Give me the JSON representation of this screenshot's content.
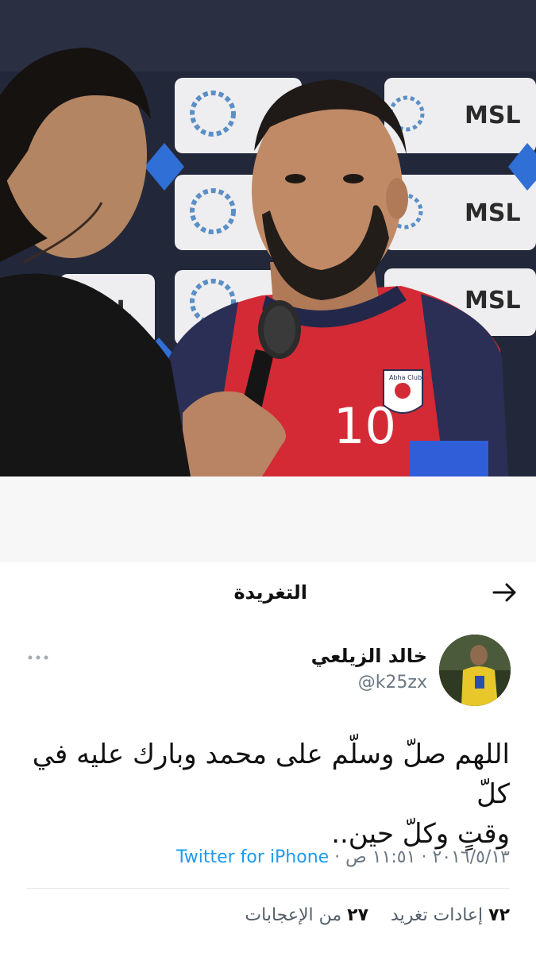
{
  "photo": {
    "backdrop_logo_text": "MSL",
    "jersey_number": "10",
    "badge_text": "Abha Club"
  },
  "tweet": {
    "header_title": "التغريدة",
    "back_icon": "arrow-right-icon",
    "author": {
      "display_name": "خالد الزيلعي",
      "handle": "@k25zx"
    },
    "more_icon": "more-dots-icon",
    "text_line_1": "اللهم صلّ وسلّم على محمد وبارك عليه في كلّ",
    "text_line_2": "وقتٍ  وكلّ حين..",
    "date": "٢٠١٦/٥/١٣",
    "separator": "·",
    "time": "١١:٥١ ص",
    "source": "Twitter for iPhone",
    "retweets_count": "٧٢",
    "retweets_label": "إعادات تغريد",
    "likes_count": "٢٧",
    "likes_label": "من الإعجابات"
  },
  "colors": {
    "source_link": "#1d9bf0",
    "secondary_text": "#6b7783",
    "jersey_red": "#d42a35",
    "sleeve_navy": "#2b2f55"
  }
}
